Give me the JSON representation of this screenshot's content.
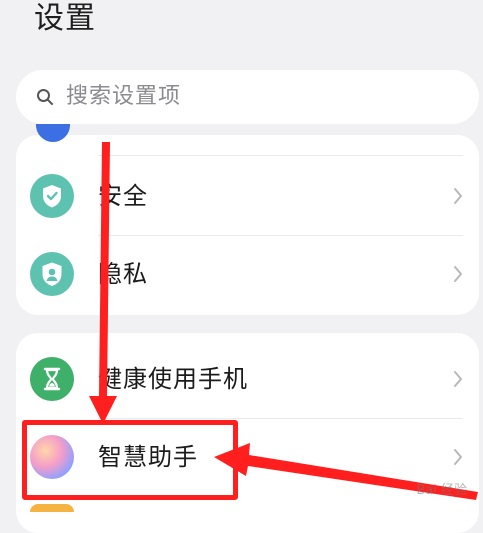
{
  "header": {
    "title": "设置"
  },
  "search": {
    "placeholder": "搜索设置项",
    "icon": "search-icon"
  },
  "settings_groups": [
    {
      "items": [
        {
          "label": "安全",
          "icon": "shield-icon",
          "icon_color": "#5ec2b0"
        },
        {
          "label": "隐私",
          "icon": "user-shield-icon",
          "icon_color": "#5ec2b0"
        }
      ]
    },
    {
      "items": [
        {
          "label": "健康使用手机",
          "icon": "hourglass-icon",
          "icon_color": "#3fb06a"
        },
        {
          "label": "智慧助手",
          "icon": "assistant-orb-icon",
          "icon_color": "#f59ec8",
          "highlighted": true
        }
      ]
    }
  ],
  "annotation": {
    "color": "#ff1f1f"
  },
  "watermark": "Bai 经验"
}
